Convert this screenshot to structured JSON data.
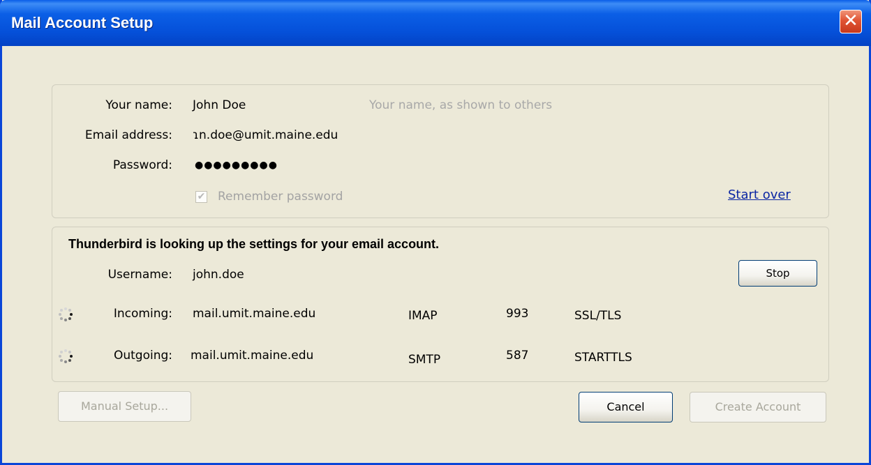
{
  "window": {
    "title": "Mail Account Setup",
    "close_glyph": "✕"
  },
  "form": {
    "name_label": "Your name:",
    "name_value": "John Doe",
    "name_hint": "Your name, as shown to others",
    "email_label": "Email address:",
    "email_value": "ɿn.doe@umit.maine.edu",
    "password_label": "Password:",
    "password_value": "●●●●●●●●●",
    "remember_label": "Remember password",
    "remember_checked": true,
    "start_over": "Start over"
  },
  "lookup": {
    "heading": "Thunderbird is looking up the settings for your email account.",
    "username_label": "Username:",
    "username_value": "john.doe",
    "stop_label": "Stop",
    "incoming": {
      "label": "Incoming:",
      "server": "mail.umit.maine.edu",
      "protocol": "IMAP",
      "port": "993",
      "security": "SSL/TLS"
    },
    "outgoing": {
      "label": "Outgoing:",
      "server": "mail.umit.maine.edu",
      "protocol": "SMTP",
      "port": "587",
      "security": "STARTTLS"
    }
  },
  "buttons": {
    "manual_setup": "Manual Setup...",
    "cancel": "Cancel",
    "create_account": "Create Account"
  },
  "icons": {
    "spinner": "loading-spinner-icon",
    "checkbox": "checkmark-icon",
    "close": "close-icon"
  },
  "colors": {
    "titlebar": "#0550d9",
    "dialog_bg": "#ece9d8",
    "link": "#0b26a3",
    "close_button": "#e05434"
  }
}
